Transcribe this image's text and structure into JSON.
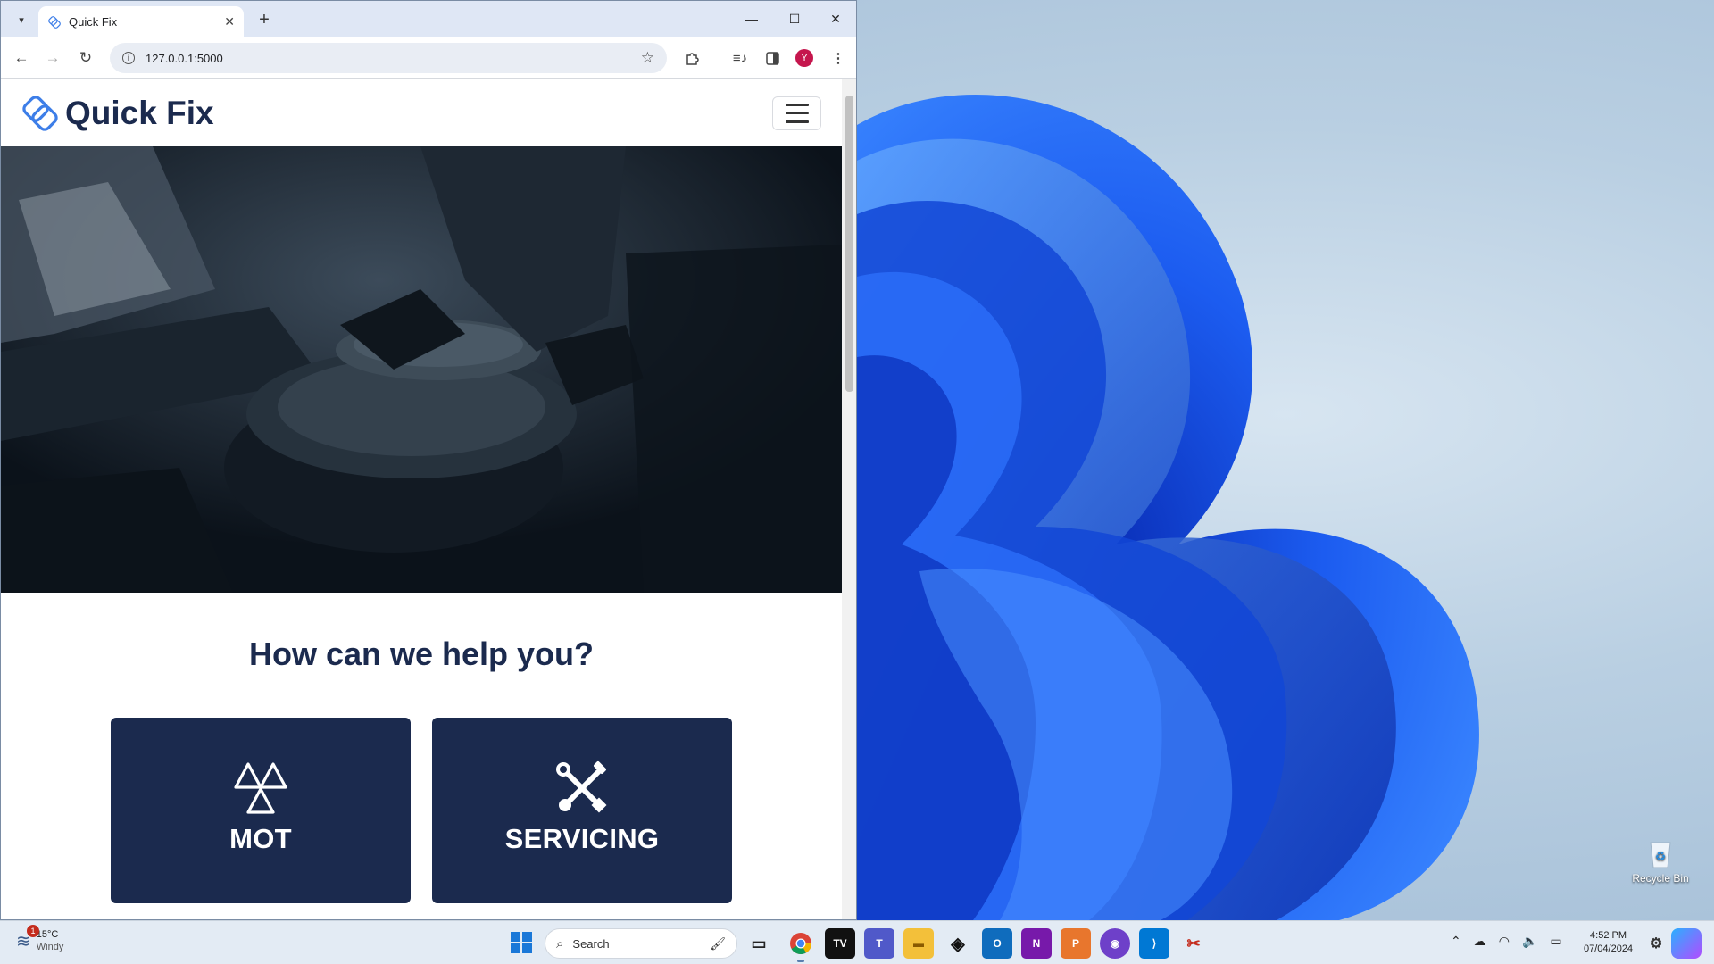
{
  "browser": {
    "tab_title": "Quick Fix",
    "tab_close": "✕",
    "new_tab": "+",
    "url": "127.0.0.1:5000",
    "profile_initial": "Y",
    "window_controls": {
      "minimize": "—",
      "maximize": "☐",
      "close": "✕"
    },
    "nav": {
      "back": "←",
      "forward": "→",
      "reload": "↻"
    },
    "icons": [
      "extensions-icon",
      "media-icon",
      "side-panel-icon",
      "menu-icon"
    ]
  },
  "site": {
    "brand": "Quick Fix",
    "heading": "How can we help you?",
    "cards": [
      {
        "label": "MOT",
        "icon": "mot-triangle-icon"
      },
      {
        "label": "SERVICING",
        "icon": "wrench-screwdriver-icon"
      }
    ]
  },
  "desktop": {
    "recycle_bin_label": "Recycle Bin"
  },
  "taskbar": {
    "weather_temp": "15°C",
    "weather_desc": "Windy",
    "weather_badge": "1",
    "search_placeholder": "Search",
    "time": "4:52 PM",
    "date": "07/04/2024",
    "apps": [
      "file-view-icon",
      "chrome-icon",
      "tradingview-icon",
      "teams-icon",
      "file-explorer-icon",
      "alienware-icon",
      "outlook-icon",
      "onenote-icon",
      "office-pdf-icon",
      "github-icon",
      "vscode-icon",
      "snipping-icon"
    ]
  },
  "colors": {
    "brand_navy": "#1b2a4e",
    "wallpaper_blue": "#1a56e8",
    "profile_red": "#c5164d"
  }
}
